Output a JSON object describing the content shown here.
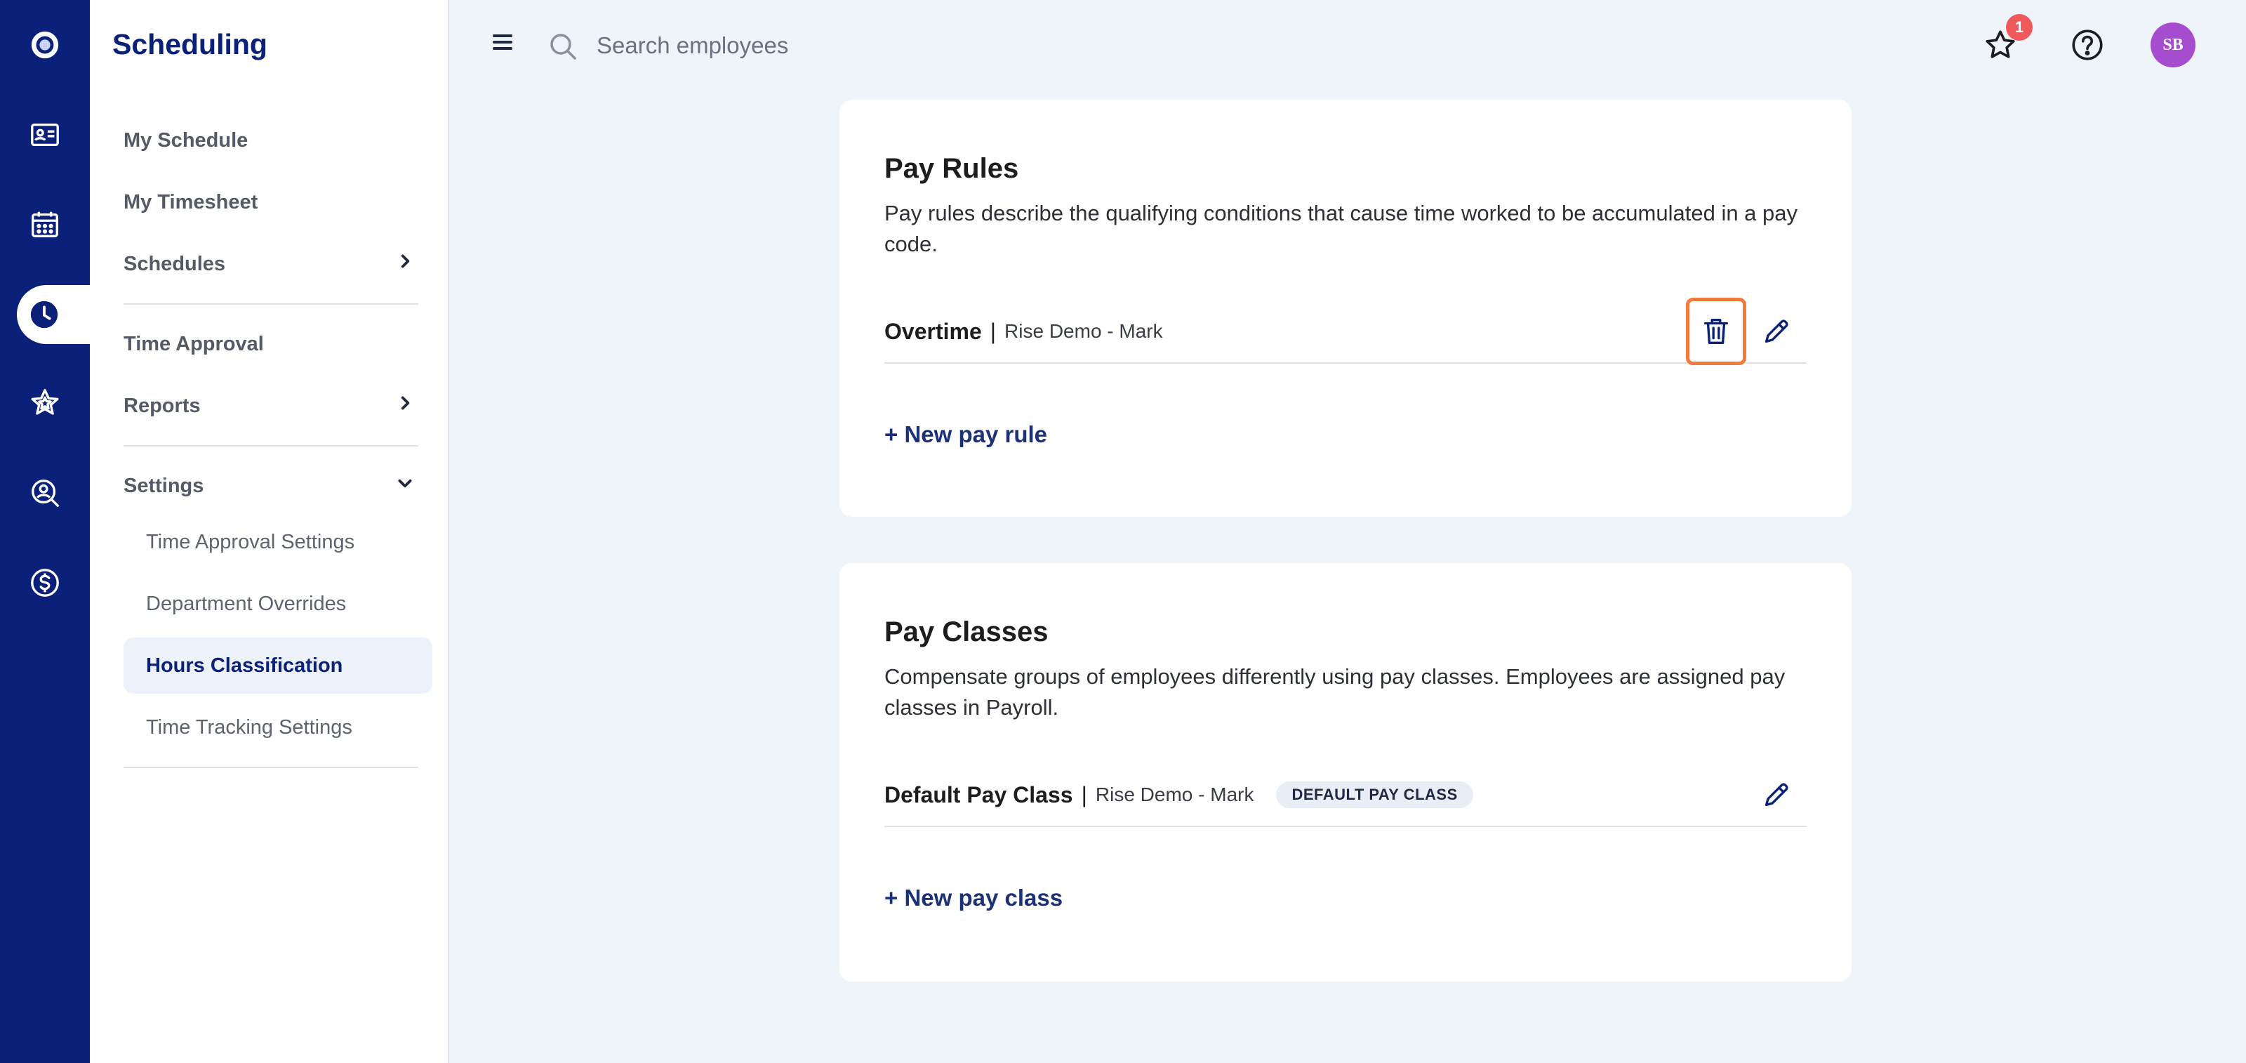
{
  "app": {
    "title": "Scheduling"
  },
  "rail": {
    "items": [
      {
        "icon": "logo-icon"
      },
      {
        "icon": "id-card-icon"
      },
      {
        "icon": "calendar-icon"
      },
      {
        "icon": "clock-icon",
        "active": true
      },
      {
        "icon": "star-badge-icon"
      },
      {
        "icon": "person-search-icon"
      },
      {
        "icon": "dollar-icon"
      }
    ]
  },
  "nav": {
    "items": [
      {
        "label": "My Schedule"
      },
      {
        "label": "My Timesheet"
      },
      {
        "label": "Schedules"
      },
      {
        "label": "Time Approval"
      },
      {
        "label": "Reports"
      },
      {
        "label": "Settings"
      }
    ],
    "settings_sub": [
      {
        "label": "Time Approval Settings"
      },
      {
        "label": "Department Overrides"
      },
      {
        "label": "Hours Classification",
        "active": true
      },
      {
        "label": "Time Tracking Settings"
      }
    ]
  },
  "topbar": {
    "search_placeholder": "Search employees",
    "notification_count": "1",
    "avatar_initials": "SB"
  },
  "pay_rules": {
    "title": "Pay Rules",
    "description": "Pay rules describe the qualifying conditions that cause time worked to be accumulated in a pay code.",
    "rows": [
      {
        "name": "Overtime",
        "separator": "|",
        "org": "Rise Demo - Mark"
      }
    ],
    "add_label": "+ New pay rule"
  },
  "pay_classes": {
    "title": "Pay Classes",
    "description": "Compensate groups of employees differently using pay classes. Employees are assigned pay classes in Payroll.",
    "rows": [
      {
        "name": "Default Pay Class",
        "separator": "|",
        "org": "Rise Demo - Mark",
        "badge": "DEFAULT PAY CLASS"
      }
    ],
    "add_label": "+ New pay class"
  },
  "colors": {
    "rail": "#0b2079",
    "accent": "#0b2079",
    "focus_ring": "#f07b3c",
    "badge": "#f0595c",
    "avatar": "#a64ccf"
  }
}
